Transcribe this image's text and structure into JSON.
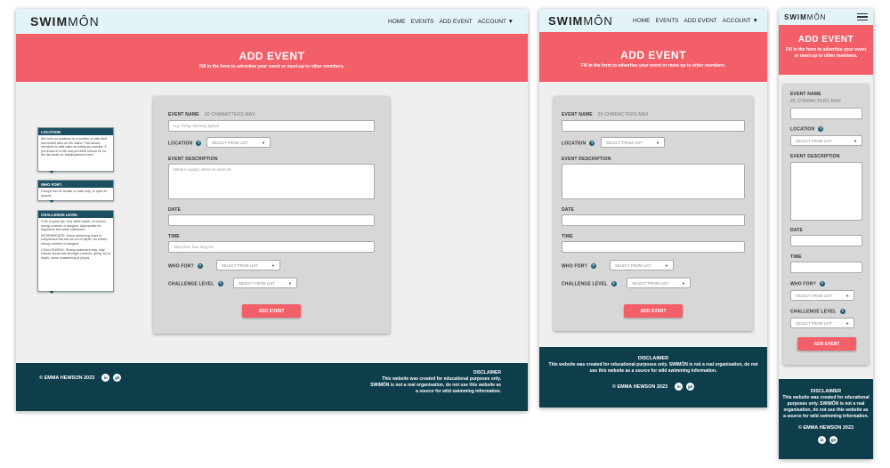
{
  "brand": {
    "bold": "SWIM",
    "light": "MÔN"
  },
  "nav": {
    "home": "HOME",
    "events": "EVENTS",
    "add_event": "ADD EVENT",
    "account": "ACCOUNT ▼"
  },
  "hero": {
    "title": "ADD EVENT",
    "subtitle": "Fill in the form to advertise your event or meet-up to other members."
  },
  "form": {
    "event_name_label": "EVENT NAME",
    "event_name_hint_desktop": "30 CHARACTERS MAX",
    "event_name_hint_small": "25 CHARACTERS MAX",
    "event_name_placeholder": "e.g. Friday Morning Splash",
    "location_label": "LOCATION",
    "select_placeholder": "SELECT FROM LIST",
    "description_label": "EVENT DESCRIPTION",
    "description_placeholder": "What to expect, where to meet etc.",
    "date_label": "DATE",
    "time_label": "TIME",
    "time_placeholder": "Start time, how long etc.",
    "who_for_label": "WHO FOR?",
    "challenge_label": "CHALLENGE LEVEL",
    "submit_label": "ADD EVENT",
    "help_icon": "?"
  },
  "tooltips": {
    "location": {
      "title": "LOCATION",
      "body": "We limit our locations to a number of safe tried and tested sites on the island. This allows members to wild swim as safely as possible. If you know of a site that you think should be on the list email us: test@swimmon.test"
    },
    "who_for": {
      "title": "WHO FOR?",
      "body": "Groups can be female or male only, or open to anyone."
    },
    "challenge": {
      "title": "CHALLENGE LEVEL",
      "fun": "FUN: A quick dip, only within depth, no known strong currents or dangers. Appropriate for beginners and weak swimmers.",
      "intermediate": "INTERMEDIATE: Some swimming close to entry/beach but can be out of depth. No known strong currents or dangers.",
      "challenging": "CHALLENGING: Strong swimmers only, may include areas with stronger currents, going out of depth, some coasteering or jumps."
    }
  },
  "footer": {
    "copyright": "© EMMA HEWSON 2023",
    "disclaimer_title": "DISCLAIMER",
    "disclaimer_line1": "This website was created for educational purposes only.",
    "disclaimer_line2": "SWIMÔN is not a real organisation, do not use this website as a source for wild swimming information.",
    "disclaimer_small": "This website was created for educational purposes only. SWIMÔN is not a real organisation, do not use this website as a source for wild swimming information.",
    "linkedin": "in",
    "github": "gh"
  },
  "colors": {
    "accent": "#f35f69",
    "nav_bg": "#e3f4f9",
    "footer_bg": "#0e3d4b",
    "help": "#1d5a73"
  },
  "icons": {
    "menu": "hamburger-icon",
    "linkedin": "linkedin-icon",
    "github": "github-icon",
    "help": "question-circle-icon",
    "chevron": "chevron-down-icon"
  }
}
